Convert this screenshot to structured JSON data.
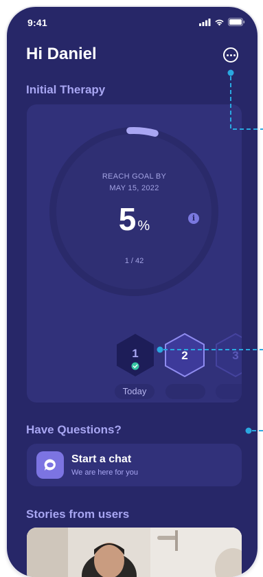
{
  "status_bar": {
    "time": "9:41"
  },
  "header": {
    "greeting": "Hi Daniel",
    "menu_icon": "ellipsis-circle-icon"
  },
  "therapy": {
    "section_title": "Initial Therapy",
    "goal_line1": "REACH GOAL BY",
    "goal_line2": "MAY 15, 2022",
    "percent_value": "5",
    "percent_symbol": "%",
    "progress_fraction": 0.05,
    "session_count": "1 / 42",
    "steps": [
      {
        "label": "1",
        "state": "completed"
      },
      {
        "label": "2",
        "state": "current"
      },
      {
        "label": "3",
        "state": "upcoming"
      }
    ],
    "day_labels": [
      "Today",
      "",
      ""
    ]
  },
  "questions": {
    "section_title": "Have Questions?",
    "chat_title": "Start a chat",
    "chat_subtitle": "We are here for you",
    "chat_icon": "chat-bubble-icon"
  },
  "stories": {
    "section_title": "Stories from users"
  },
  "colors": {
    "background": "#272768",
    "card": "#31317a",
    "accent": "#a8a6f2",
    "annotation": "#2aa8e0"
  }
}
